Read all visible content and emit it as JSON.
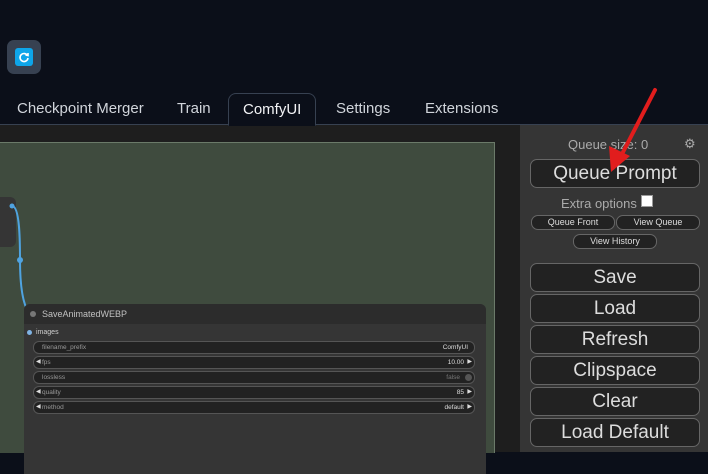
{
  "tabs": [
    "Checkpoint Merger",
    "Train",
    "ComfyUI",
    "Settings",
    "Extensions"
  ],
  "active_tab": "ComfyUI",
  "node": {
    "title": "SaveAnimatedWEBP",
    "input_label": "images",
    "widgets": [
      {
        "label": "filename_prefix",
        "value": "ComfyUI"
      },
      {
        "label": "fps",
        "value": "10.00"
      },
      {
        "label": "lossless",
        "value": "false"
      },
      {
        "label": "quality",
        "value": "85"
      },
      {
        "label": "method",
        "value": "default"
      }
    ]
  },
  "panel": {
    "queue_size": "Queue size: 0",
    "queue_prompt": "Queue Prompt",
    "extra_options": "Extra options",
    "queue_front": "Queue Front",
    "view_queue": "View Queue",
    "view_history": "View History",
    "save": "Save",
    "load": "Load",
    "refresh": "Refresh",
    "clipspace": "Clipspace",
    "clear": "Clear",
    "load_default": "Load Default"
  },
  "colors": {
    "background": "#0b0f19",
    "canvas": "#3f4b3e",
    "panel": "#353535",
    "arrow": "#e11d1d",
    "link": "#4fa3e0"
  }
}
